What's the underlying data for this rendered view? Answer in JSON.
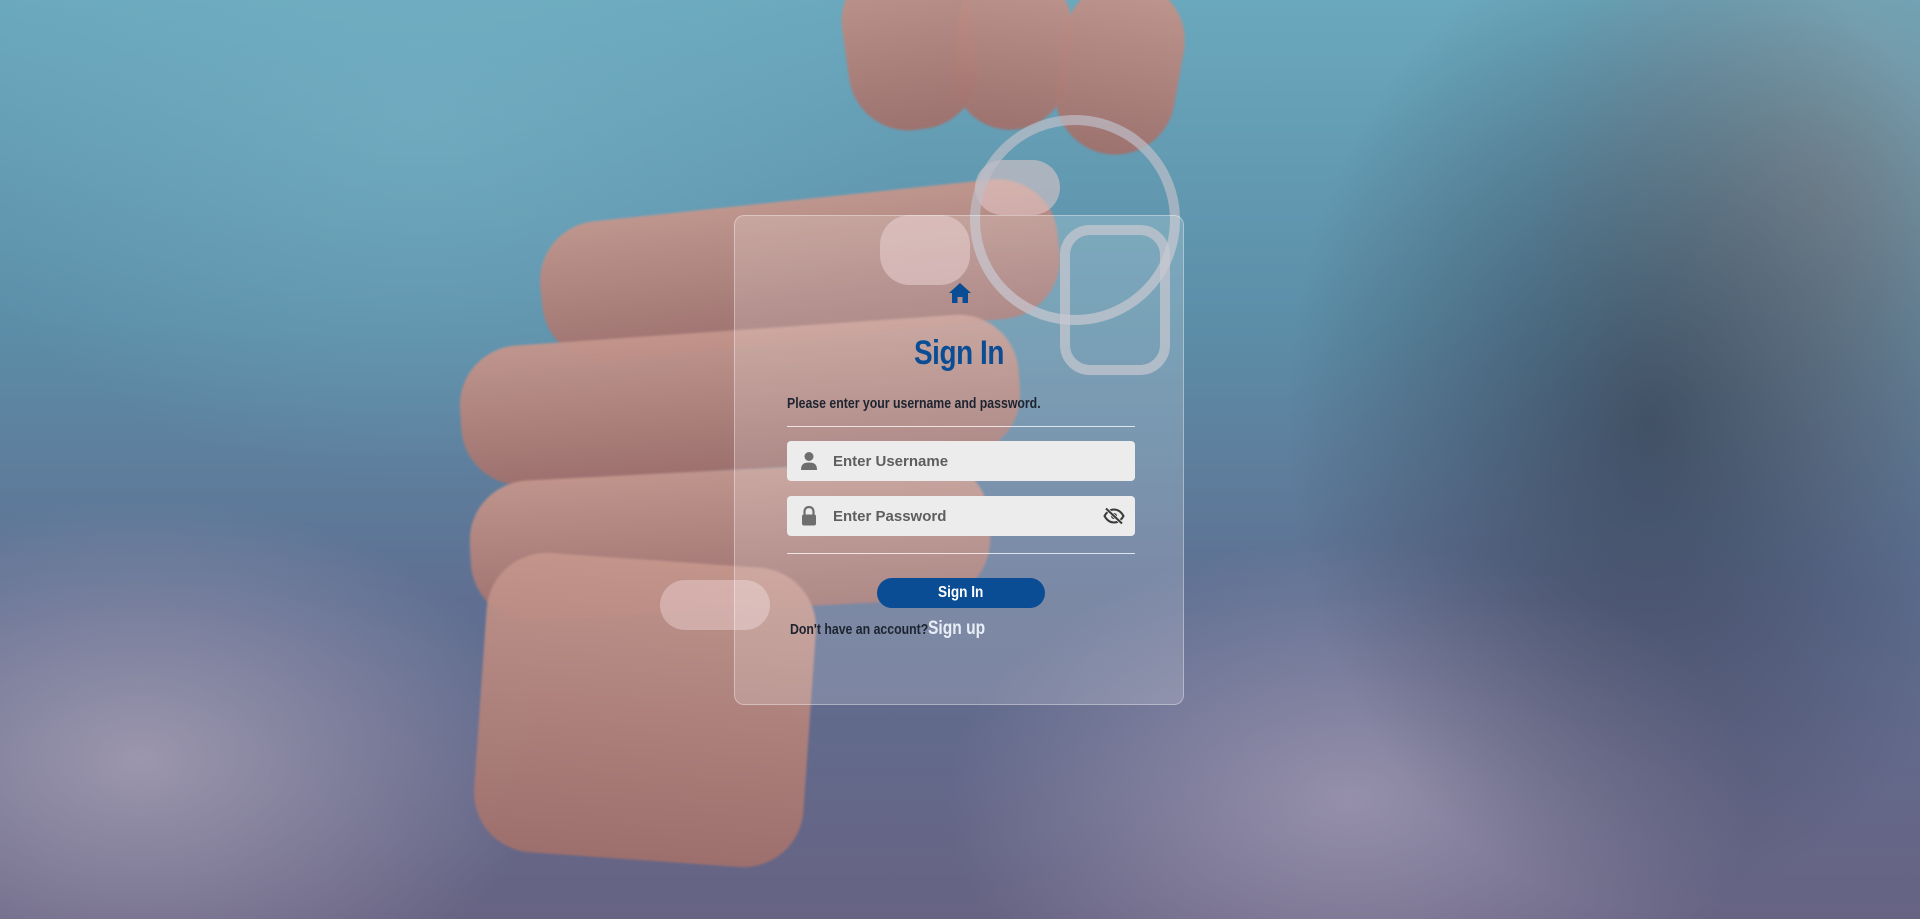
{
  "app": {
    "title": "Sign In",
    "subtitle": "Please enter your username and password."
  },
  "icons": {
    "home": "home-icon",
    "user": "user-icon",
    "lock": "lock-icon",
    "eye": "eye-slash-icon"
  },
  "form": {
    "username": {
      "value": "",
      "placeholder": "Enter Username"
    },
    "password": {
      "value": "",
      "placeholder": "Enter Password"
    },
    "submit_label": "Sign In"
  },
  "footer": {
    "prompt": "Don't have an account?",
    "signup_label": "Sign up"
  },
  "colors": {
    "accent": "#0a4d94",
    "field_bg": "#ececec",
    "text_dark": "#1d2430",
    "link": "#e7eef5"
  }
}
